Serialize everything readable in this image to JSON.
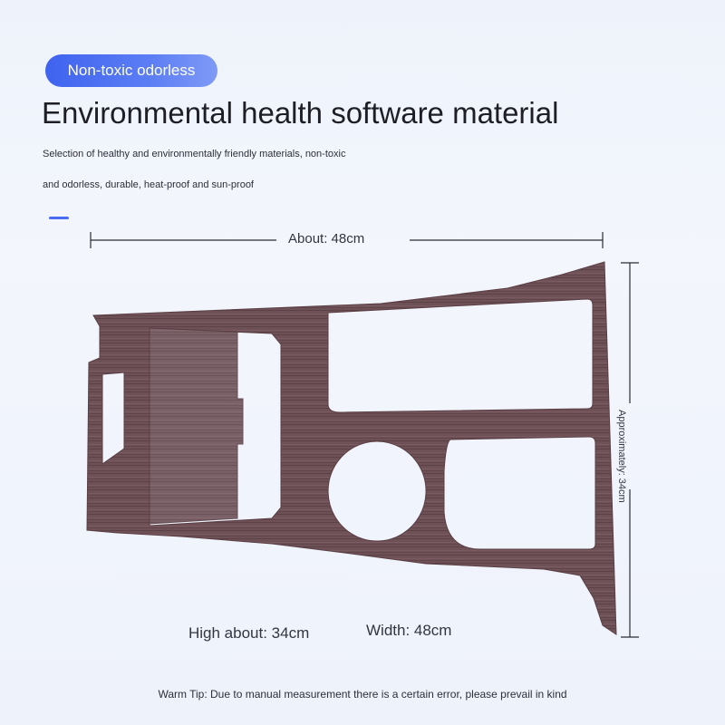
{
  "badge": {
    "text": "Non-toxic odorless",
    "color": "#4a6cf0"
  },
  "headline": "Environmental health software material",
  "description": {
    "line1": "Selection of healthy and environmentally friendly materials, non-toxic",
    "line2": "and odorless, durable, heat-proof and sun-proof"
  },
  "dimensions": {
    "top_label": "About: 48cm",
    "side_label": "Approximately: 34cm",
    "height_label": "High about: 34cm",
    "width_label": "Width: 48cm"
  },
  "product": {
    "name": "console-panel-sticker",
    "color": "#6e5157",
    "stripe_color": "#5a3f45"
  },
  "tip": "Warm Tip: Due to manual measurement there is a certain error, please prevail in kind"
}
